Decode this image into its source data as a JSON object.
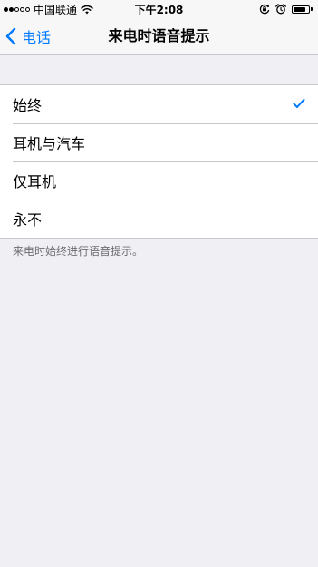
{
  "status_bar": {
    "carrier": "中国联通",
    "time": "下午2:08",
    "signal_bars_filled": 2,
    "signal_bars_total": 5,
    "battery_level": 0.8,
    "icons": [
      "wifi-icon",
      "rotation-lock-icon",
      "alarm-icon",
      "battery-icon"
    ]
  },
  "nav": {
    "back_label": "电话",
    "title": "来电时语音提示"
  },
  "options": [
    {
      "label": "始终",
      "selected": true
    },
    {
      "label": "耳机与汽车",
      "selected": false
    },
    {
      "label": "仅耳机",
      "selected": false
    },
    {
      "label": "永不",
      "selected": false
    }
  ],
  "footer": "来电时始终进行语音提示。",
  "colors": {
    "accent": "#007aff",
    "background": "#efeff4",
    "separator": "#c8c7cc",
    "footer_text": "#6d6d72"
  }
}
